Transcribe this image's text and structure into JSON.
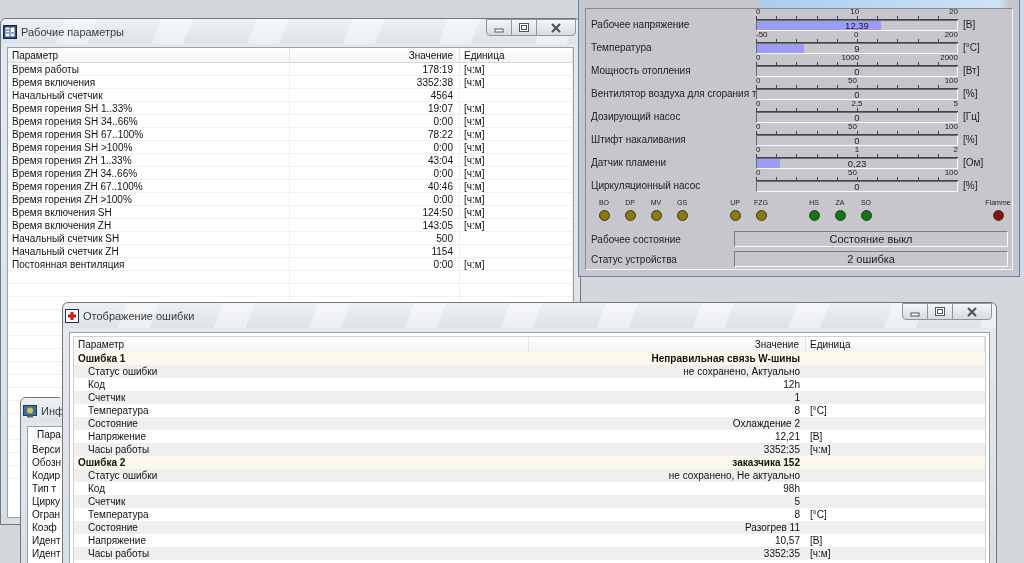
{
  "operating_window": {
    "title": "Рабочие параметры",
    "columns": [
      "Параметр",
      "Значение",
      "Единица"
    ],
    "rows": [
      {
        "name": "Время работы",
        "value": "178:19",
        "unit": "[ч:м]"
      },
      {
        "name": "Время включения",
        "value": "3352:38",
        "unit": "[ч:м]"
      },
      {
        "name": "Начальный счетчик",
        "value": "4564"
      },
      {
        "name": "Время горения SH 1..33%",
        "value": "19:07",
        "unit": "[ч:м]"
      },
      {
        "name": "Время горения SH 34..66%",
        "value": "0:00",
        "unit": "[ч:м]"
      },
      {
        "name": "Время горения SH 67..100%",
        "value": "78:22",
        "unit": "[ч:м]"
      },
      {
        "name": "Время горения SH >100%",
        "value": "0:00",
        "unit": "[ч:м]"
      },
      {
        "name": "Время горения ZH 1..33%",
        "value": "43:04",
        "unit": "[ч:м]"
      },
      {
        "name": "Время горения ZH 34..66%",
        "value": "0:00",
        "unit": "[ч:м]"
      },
      {
        "name": "Время горения ZH 67..100%",
        "value": "40:46",
        "unit": "[ч:м]"
      },
      {
        "name": "Время горения ZH >100%",
        "value": "0:00",
        "unit": "[ч:м]"
      },
      {
        "name": "Время включения SH",
        "value": "124:50",
        "unit": "[ч:м]"
      },
      {
        "name": "Время включения ZH",
        "value": "143:05",
        "unit": "[ч:м]"
      },
      {
        "name": "Начальный счетчик SH",
        "value": "500"
      },
      {
        "name": "Начальный счетчик ZH",
        "value": "1154"
      },
      {
        "name": "Постоянная вентиляция",
        "value": "0:00",
        "unit": "[ч:м]"
      }
    ]
  },
  "gauge_panel": {
    "gauges": [
      {
        "label": "Рабочее напряжение",
        "ticks": [
          "0",
          "10",
          "20"
        ],
        "level": 0.62,
        "reading": "12,39",
        "unit": "[В]"
      },
      {
        "label": "Температура",
        "ticks": [
          "-50",
          "0",
          "200"
        ],
        "level": 0.236,
        "reading": "9",
        "unit": "[°C]"
      },
      {
        "label": "Мощность отопления",
        "ticks": [
          "0",
          "1000",
          "2000"
        ],
        "level": 0,
        "reading": "0",
        "unit": "[Вт]"
      },
      {
        "label": "Вентилятор воздуха для сгорания т",
        "ticks": [
          "0",
          "50",
          "100"
        ],
        "level": 0,
        "reading": "0",
        "unit": "[%]"
      },
      {
        "label": "Дозирующий насос",
        "ticks": [
          "0",
          "2,5",
          "5"
        ],
        "level": 0,
        "reading": "0",
        "unit": "[Гц]"
      },
      {
        "label": "Штифт накаливания",
        "ticks": [
          "0",
          "50",
          "100"
        ],
        "level": 0,
        "reading": "0",
        "unit": "[%]"
      },
      {
        "label": "Датчик пламени",
        "ticks": [
          "0",
          "1",
          "2"
        ],
        "level": 0.115,
        "reading": "0,23",
        "unit": "[Ом]"
      },
      {
        "label": "Циркуляционный насос",
        "ticks": [
          "0",
          "50",
          "100"
        ],
        "level": 0,
        "reading": "0",
        "unit": "[%]"
      }
    ],
    "led_groups": [
      {
        "leds": [
          {
            "label": "BO",
            "color": "#8a7b06"
          },
          {
            "label": "DP",
            "color": "#8a7b06"
          },
          {
            "label": "MV",
            "color": "#8a7b06"
          },
          {
            "label": "GS",
            "color": "#8a7b06"
          }
        ]
      },
      {
        "leds": [
          {
            "label": "UP",
            "color": "#8a7b06"
          },
          {
            "label": "FZG",
            "color": "#8a7b06"
          }
        ]
      },
      {
        "leds": [
          {
            "label": "HS",
            "color": "#0b7a12"
          },
          {
            "label": "ZA",
            "color": "#0b7a12"
          },
          {
            "label": "SO",
            "color": "#0b7a12"
          }
        ]
      },
      {
        "leds": [
          {
            "label": "Flamme",
            "color": "#8c0d14"
          }
        ]
      }
    ],
    "status_fields": [
      {
        "label": "Рабочее состояние",
        "value": "Состояние выкл"
      },
      {
        "label": "Статус устройства",
        "value": "2 ошибка"
      }
    ]
  },
  "info_window": {
    "title": "Инф",
    "header": "Пара",
    "rows": [
      "Верси",
      "Обозн",
      "Кодир",
      "Тип т",
      "Цирку",
      "Огран",
      "Коэф",
      "Идент",
      "Идент"
    ]
  },
  "error_window": {
    "title": "Отображение ошибки",
    "columns": [
      "Параметр",
      "Значение",
      "Единица"
    ],
    "errors": [
      {
        "name": "Ошибка 1",
        "value": "Неправильная связь W-шины",
        "children": [
          {
            "name": "Статус ошибки",
            "value": "не сохранено, Актуально"
          },
          {
            "name": "Код",
            "value": "12h"
          },
          {
            "name": "Счетчик",
            "value": "1"
          },
          {
            "name": "Температура",
            "value": "8",
            "unit": "[°C]"
          },
          {
            "name": "Состояние",
            "value": "Охлаждение 2"
          },
          {
            "name": "Напряжение",
            "value": "12,21",
            "unit": "[В]"
          },
          {
            "name": "Часы работы",
            "value": "3352:35",
            "unit": "[ч:м]"
          }
        ]
      },
      {
        "name": "Ошибка 2",
        "value": "заказчика 152",
        "children": [
          {
            "name": "Статус ошибки",
            "value": "не сохранено, Не актуально"
          },
          {
            "name": "Код",
            "value": "98h"
          },
          {
            "name": "Счетчик",
            "value": "5"
          },
          {
            "name": "Температура",
            "value": "8",
            "unit": "[°C]"
          },
          {
            "name": "Состояние",
            "value": "Разогрев 11"
          },
          {
            "name": "Напряжение",
            "value": "10,57",
            "unit": "[В]"
          },
          {
            "name": "Часы работы",
            "value": "3352:35",
            "unit": "[ч:м]"
          }
        ]
      }
    ]
  }
}
